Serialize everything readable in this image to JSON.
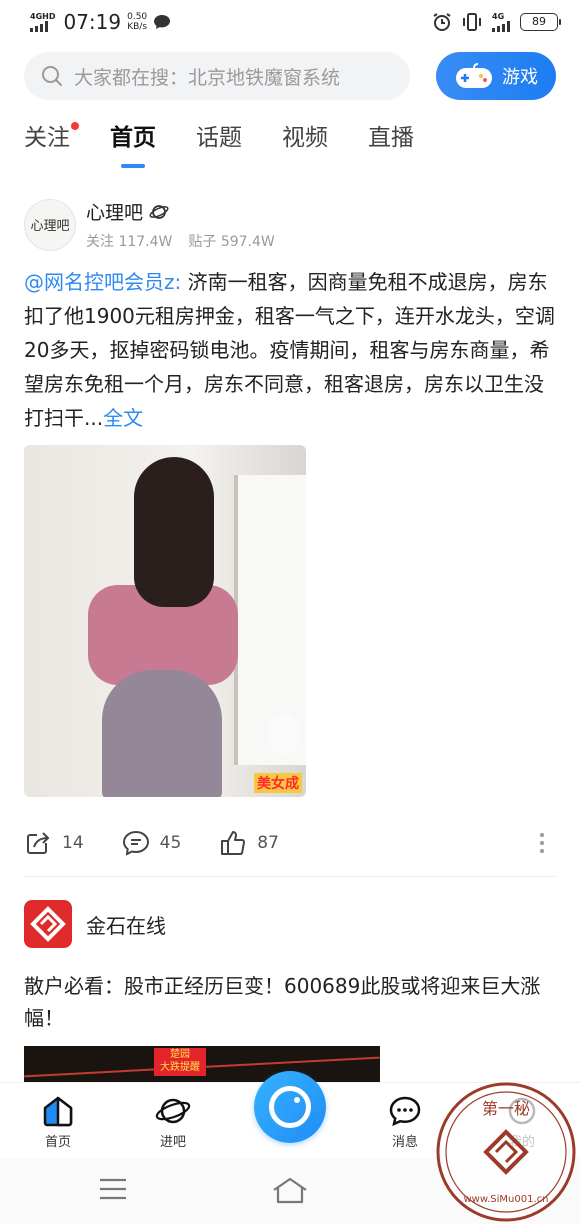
{
  "status_bar": {
    "network": "4GHD",
    "time": "07:19",
    "speed_value": "0.50",
    "speed_unit": "KB/s",
    "network2": "4G",
    "battery": "89"
  },
  "search": {
    "placeholder": "大家都在搜：北京地铁魔窗系统",
    "game_label": "游戏"
  },
  "tabs": [
    {
      "label": "关注"
    },
    {
      "label": "首页"
    },
    {
      "label": "话题"
    },
    {
      "label": "视频"
    },
    {
      "label": "直播"
    }
  ],
  "post1": {
    "avatar_text": "心理吧",
    "forum_name": "心理吧",
    "follow": "关注 117.4W",
    "posts": "贴子 597.4W",
    "mention": "@网名控吧会员z:",
    "body": " 济南一租客，因商量免租不成退房，房东扣了他1900元租房押金，租客一气之下，连开水龙头，空调20多天，抠掉密码锁电池。疫情期间，租客与房东商量，希望房东免租一个月，房东不同意，租客退房，房东以卫生没打扫干...",
    "more": "全文",
    "image_tag": "美女成",
    "shares": "14",
    "comments": "45",
    "likes": "87"
  },
  "post2": {
    "name": "金石在线",
    "text": "散户必看：股市正经历巨变！600689此股或将迎来巨大涨幅！",
    "badge_line1": "楚园",
    "badge_line2": "大跌提醒"
  },
  "bottom_nav": {
    "home": "首页",
    "enter": "进吧",
    "messages": "消息",
    "mine": "我的"
  },
  "watermark": {
    "top_text": "第一秘",
    "bottom_text": "www.SiMu001.cn"
  },
  "colors": {
    "accent": "#2e89f5",
    "red_dot": "#f23a3a",
    "ad_red": "#e02b2b"
  }
}
